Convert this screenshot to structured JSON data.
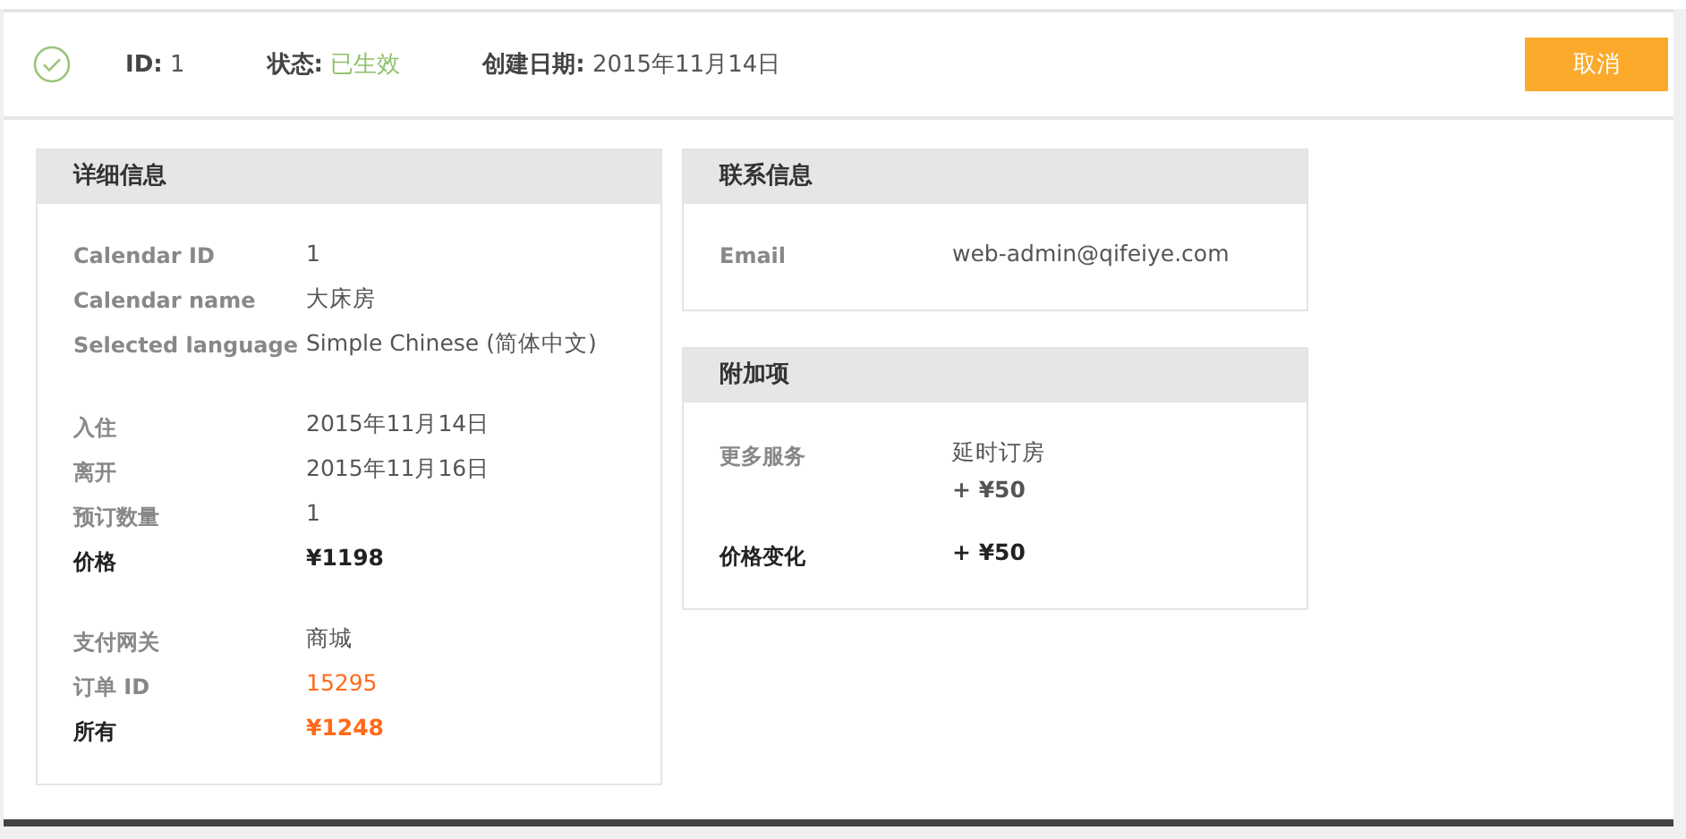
{
  "header": {
    "verified": true,
    "fields": [
      {
        "label": "ID:",
        "value": "1",
        "kind": "plain"
      },
      {
        "label": "状态:",
        "value": "已生效",
        "kind": "success"
      },
      {
        "label": "创建日期:",
        "value": "2015年11月14日",
        "kind": "plain"
      }
    ],
    "cancel_button": "取消"
  },
  "columns": [
    [
      {
        "title": "详细信息",
        "groups": [
          [
            {
              "label": "Calendar ID",
              "values": [
                "1"
              ],
              "kind": "plain"
            },
            {
              "label": "Calendar name",
              "values": [
                "大床房"
              ],
              "kind": "plain"
            },
            {
              "label": "Selected language",
              "values": [
                "Simple Chinese (简体中文)"
              ],
              "kind": "plain"
            }
          ],
          [
            {
              "label": "入住",
              "values": [
                "2015年11月14日"
              ],
              "kind": "plain"
            },
            {
              "label": "离开",
              "values": [
                "2015年11月16日"
              ],
              "kind": "plain"
            },
            {
              "label": "预订数量",
              "values": [
                "1"
              ],
              "kind": "plain"
            },
            {
              "label": "价格",
              "values": [
                "¥1198"
              ],
              "kind": "strong"
            }
          ],
          [
            {
              "label": "支付网关",
              "values": [
                "商城"
              ],
              "kind": "plain"
            },
            {
              "label": "订单 ID",
              "values": [
                "15295"
              ],
              "kind": "link"
            },
            {
              "label": "所有",
              "values": [
                "¥1248"
              ],
              "kind": "total"
            }
          ]
        ]
      }
    ],
    [
      {
        "title": "联系信息",
        "groups": [
          [
            {
              "label": "Email",
              "values": [
                "web-admin@qifeiye.com"
              ],
              "kind": "plain"
            }
          ]
        ]
      },
      {
        "title": "附加项",
        "groups": [
          [
            {
              "label": "更多服务",
              "values": [
                "延时订房",
                "+ ¥50"
              ],
              "kind": "plain"
            }
          ],
          [
            {
              "label": "价格变化",
              "values": [
                "+ ¥50"
              ],
              "kind": "strong"
            }
          ]
        ]
      }
    ]
  ]
}
